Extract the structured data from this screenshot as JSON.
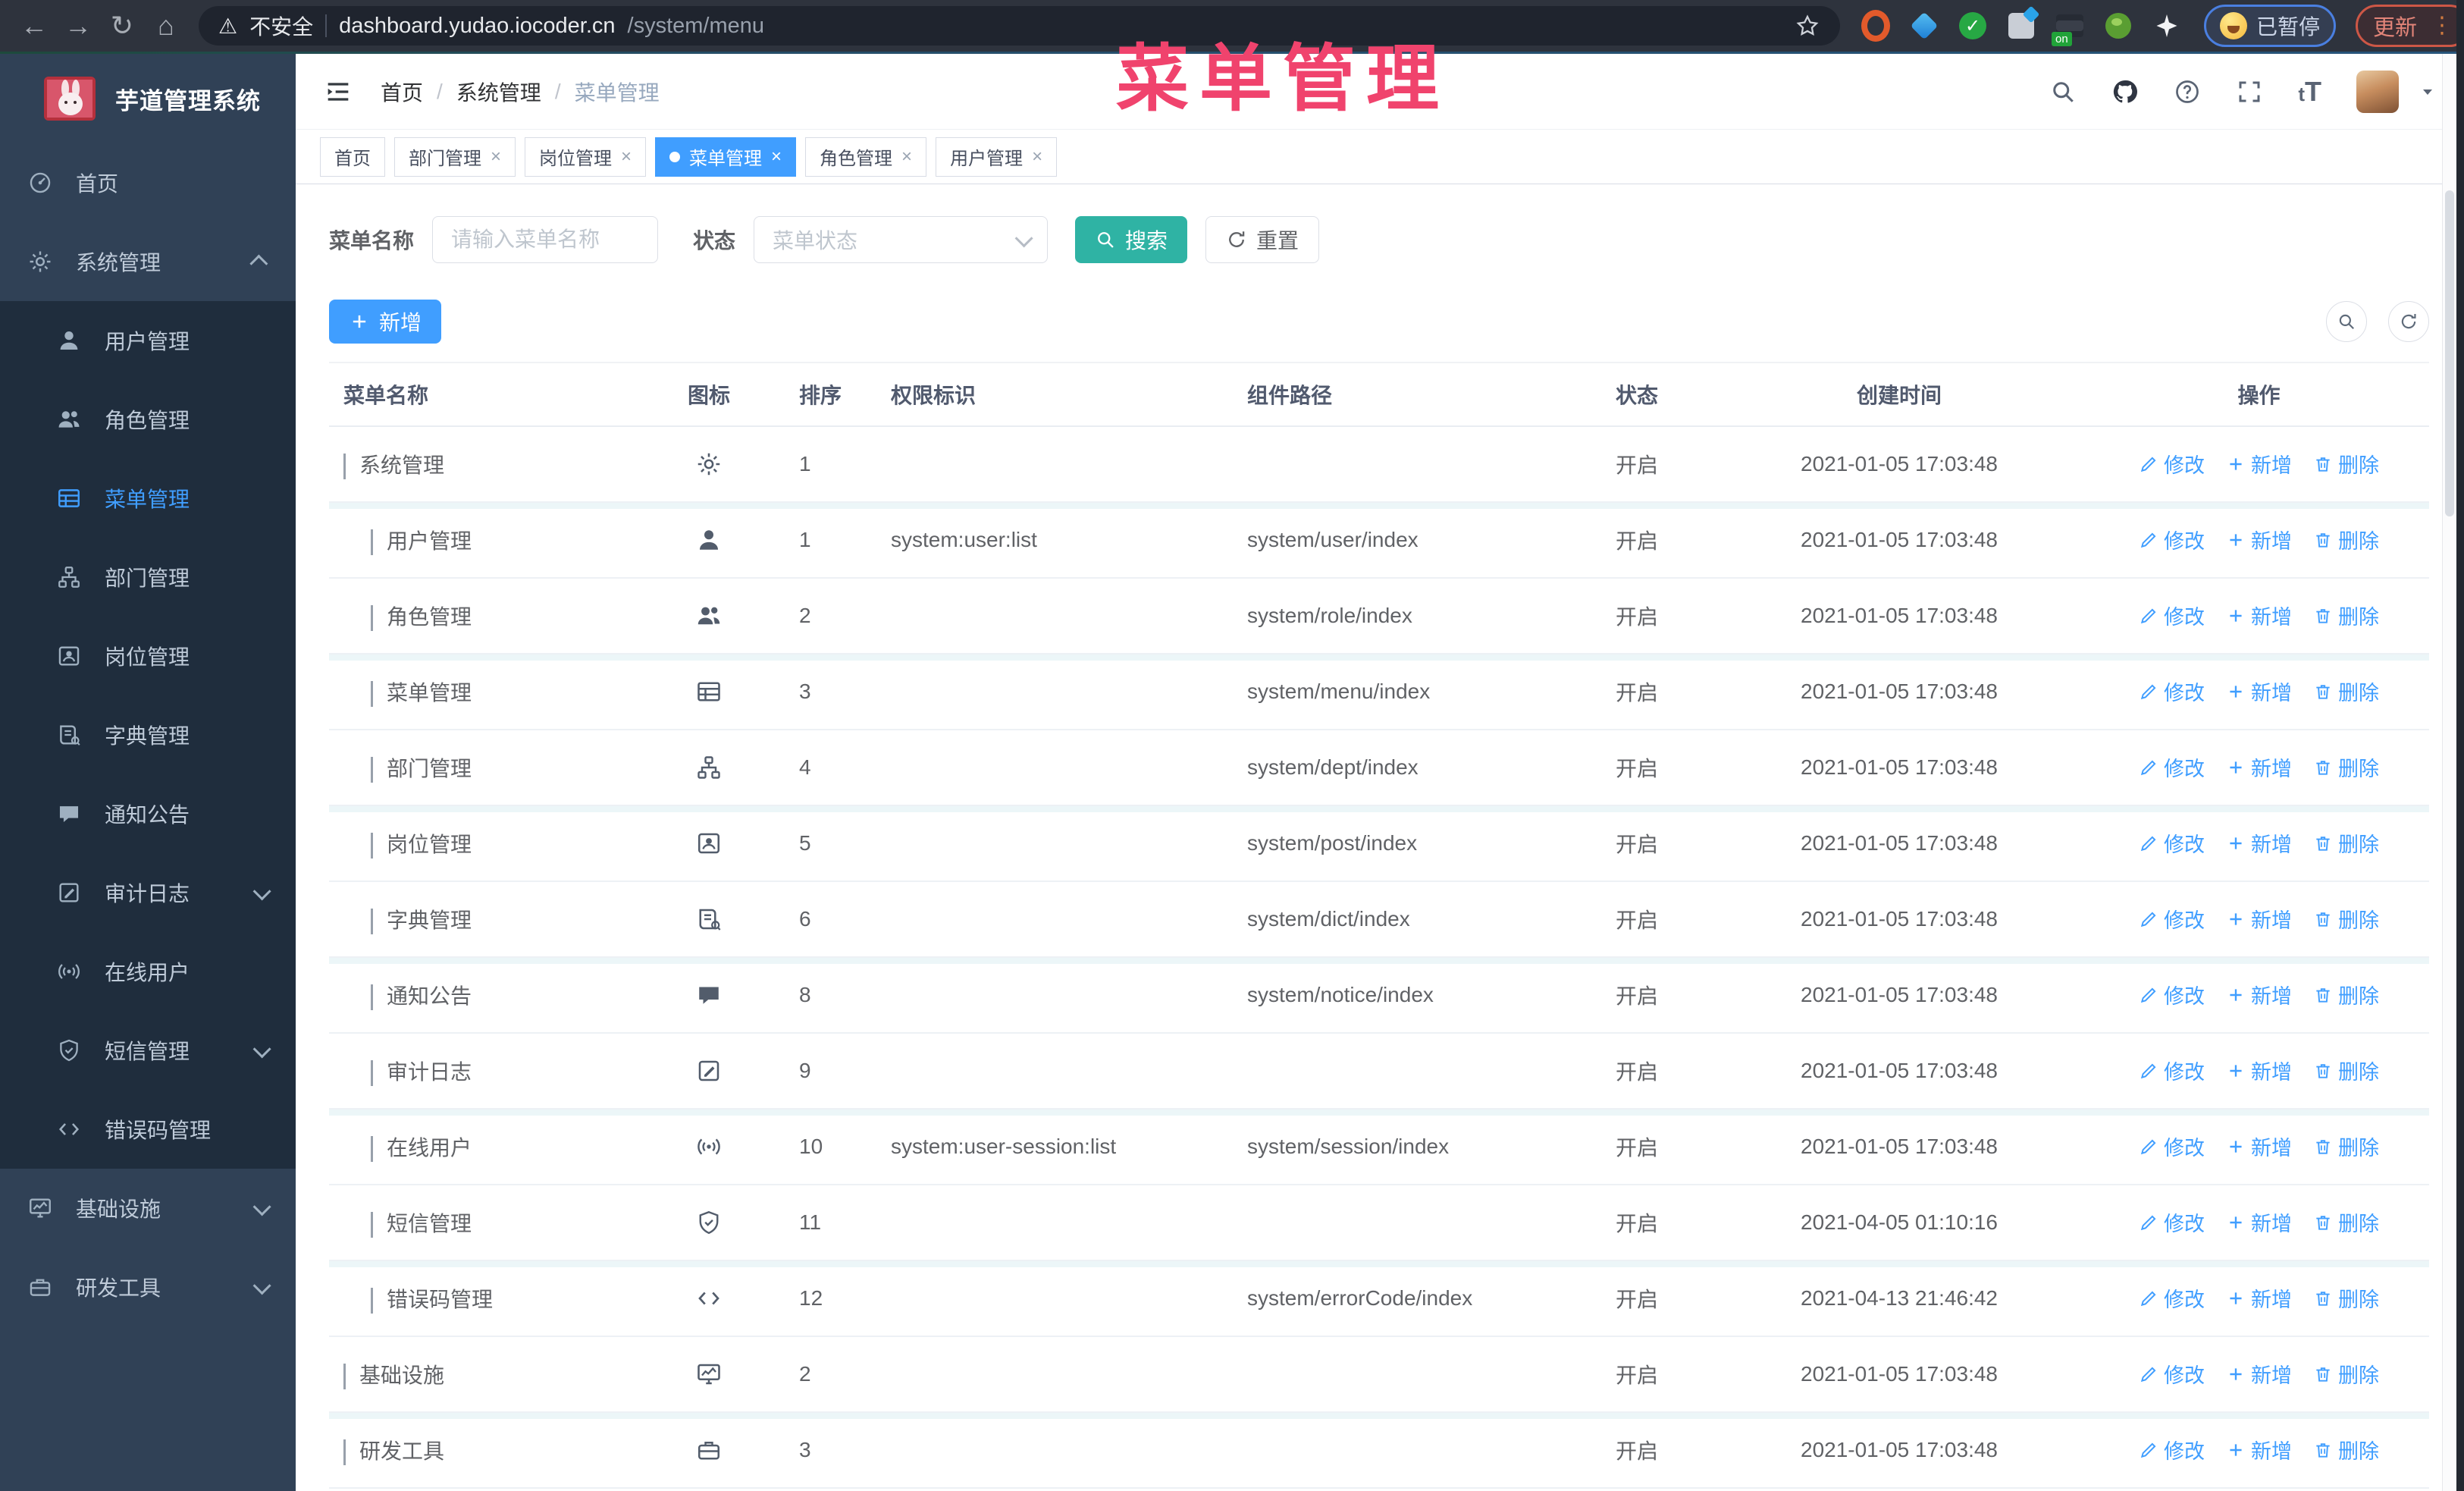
{
  "colors": {
    "primary": "#409eff",
    "teal": "#2fb3a4",
    "watermark_pink": "#f0436d",
    "sidebar_bg": "#304156",
    "submenu_bg": "#1f2d3d",
    "active_tab": "#409eff"
  },
  "watermark": "菜单管理",
  "browser": {
    "security_label": "不安全",
    "url_host": "dashboard.yudao.iocoder.cn",
    "url_path": "/system/menu",
    "paused_badge": "已暂停",
    "update_button": "更新"
  },
  "sidebar": {
    "logo_title": "芋道管理系统",
    "menu": [
      {
        "label": "首页",
        "icon": "dashboard-icon"
      },
      {
        "label": "系统管理",
        "icon": "gear-icon",
        "chevron": "up",
        "children": [
          {
            "label": "用户管理",
            "icon": "user-icon"
          },
          {
            "label": "角色管理",
            "icon": "peoples-icon"
          },
          {
            "label": "菜单管理",
            "icon": "tree-table-icon",
            "active": true
          },
          {
            "label": "部门管理",
            "icon": "tree-icon"
          },
          {
            "label": "岗位管理",
            "icon": "post-icon"
          },
          {
            "label": "字典管理",
            "icon": "dict-icon"
          },
          {
            "label": "通知公告",
            "icon": "message-icon"
          },
          {
            "label": "审计日志",
            "icon": "log-icon",
            "chevron": "down"
          },
          {
            "label": "在线用户",
            "icon": "online-icon"
          },
          {
            "label": "短信管理",
            "icon": "shield-icon",
            "chevron": "down"
          },
          {
            "label": "错误码管理",
            "icon": "code-icon"
          }
        ]
      },
      {
        "label": "基础设施",
        "icon": "monitor-icon",
        "chevron": "down"
      },
      {
        "label": "研发工具",
        "icon": "tool-icon",
        "chevron": "down"
      }
    ]
  },
  "header": {
    "breadcrumb": [
      "首页",
      "系统管理",
      "菜单管理"
    ]
  },
  "tabs": [
    {
      "label": "首页",
      "closable": false
    },
    {
      "label": "部门管理",
      "closable": true
    },
    {
      "label": "岗位管理",
      "closable": true
    },
    {
      "label": "菜单管理",
      "closable": true,
      "active": true
    },
    {
      "label": "角色管理",
      "closable": true
    },
    {
      "label": "用户管理",
      "closable": true
    }
  ],
  "filters": {
    "name_label": "菜单名称",
    "name_placeholder": "请输入菜单名称",
    "status_label": "状态",
    "status_placeholder": "菜单状态",
    "search_label": "搜索",
    "reset_label": "重置"
  },
  "toolbar": {
    "add_label": "新增"
  },
  "table": {
    "columns": [
      "菜单名称",
      "图标",
      "排序",
      "权限标识",
      "组件路径",
      "状态",
      "创建时间",
      "操作"
    ],
    "actions": {
      "edit": "修改",
      "add": "新增",
      "delete": "删除"
    },
    "rows": [
      {
        "name": "系统管理",
        "icon": "gear-icon",
        "expand": "open",
        "level": 0,
        "sort": "1",
        "perm": "",
        "path": "",
        "status": "开启",
        "time": "2021-01-05 17:03:48"
      },
      {
        "name": "用户管理",
        "icon": "user-icon",
        "expand": "closed",
        "level": 1,
        "sort": "1",
        "perm": "system:user:list",
        "path": "system/user/index",
        "status": "开启",
        "time": "2021-01-05 17:03:48"
      },
      {
        "name": "角色管理",
        "icon": "peoples-icon",
        "expand": "closed",
        "level": 1,
        "sort": "2",
        "perm": "",
        "path": "system/role/index",
        "status": "开启",
        "time": "2021-01-05 17:03:48"
      },
      {
        "name": "菜单管理",
        "icon": "tree-table-icon",
        "expand": "closed",
        "level": 1,
        "sort": "3",
        "perm": "",
        "path": "system/menu/index",
        "status": "开启",
        "time": "2021-01-05 17:03:48"
      },
      {
        "name": "部门管理",
        "icon": "tree-icon",
        "expand": "closed",
        "level": 1,
        "sort": "4",
        "perm": "",
        "path": "system/dept/index",
        "status": "开启",
        "time": "2021-01-05 17:03:48"
      },
      {
        "name": "岗位管理",
        "icon": "post-icon",
        "expand": "closed",
        "level": 1,
        "sort": "5",
        "perm": "",
        "path": "system/post/index",
        "status": "开启",
        "time": "2021-01-05 17:03:48"
      },
      {
        "name": "字典管理",
        "icon": "dict-icon",
        "expand": "closed",
        "level": 1,
        "sort": "6",
        "perm": "",
        "path": "system/dict/index",
        "status": "开启",
        "time": "2021-01-05 17:03:48"
      },
      {
        "name": "通知公告",
        "icon": "message-icon",
        "expand": "closed",
        "level": 1,
        "sort": "8",
        "perm": "",
        "path": "system/notice/index",
        "status": "开启",
        "time": "2021-01-05 17:03:48"
      },
      {
        "name": "审计日志",
        "icon": "log-icon",
        "expand": "closed",
        "level": 1,
        "sort": "9",
        "perm": "",
        "path": "",
        "status": "开启",
        "time": "2021-01-05 17:03:48"
      },
      {
        "name": "在线用户",
        "icon": "online-icon",
        "expand": "closed",
        "level": 1,
        "sort": "10",
        "perm": "system:user-session:list",
        "path": "system/session/index",
        "status": "开启",
        "time": "2021-01-05 17:03:48"
      },
      {
        "name": "短信管理",
        "icon": "shield-icon",
        "expand": "closed",
        "level": 1,
        "sort": "11",
        "perm": "",
        "path": "",
        "status": "开启",
        "time": "2021-04-05 01:10:16"
      },
      {
        "name": "错误码管理",
        "icon": "code-icon",
        "expand": "closed",
        "level": 1,
        "sort": "12",
        "perm": "",
        "path": "system/errorCode/index",
        "status": "开启",
        "time": "2021-04-13 21:46:42"
      },
      {
        "name": "基础设施",
        "icon": "monitor-icon",
        "expand": "closed",
        "level": 0,
        "sort": "2",
        "perm": "",
        "path": "",
        "status": "开启",
        "time": "2021-01-05 17:03:48"
      },
      {
        "name": "研发工具",
        "icon": "tool-icon",
        "expand": "closed",
        "level": 0,
        "sort": "3",
        "perm": "",
        "path": "",
        "status": "开启",
        "time": "2021-01-05 17:03:48"
      }
    ]
  }
}
